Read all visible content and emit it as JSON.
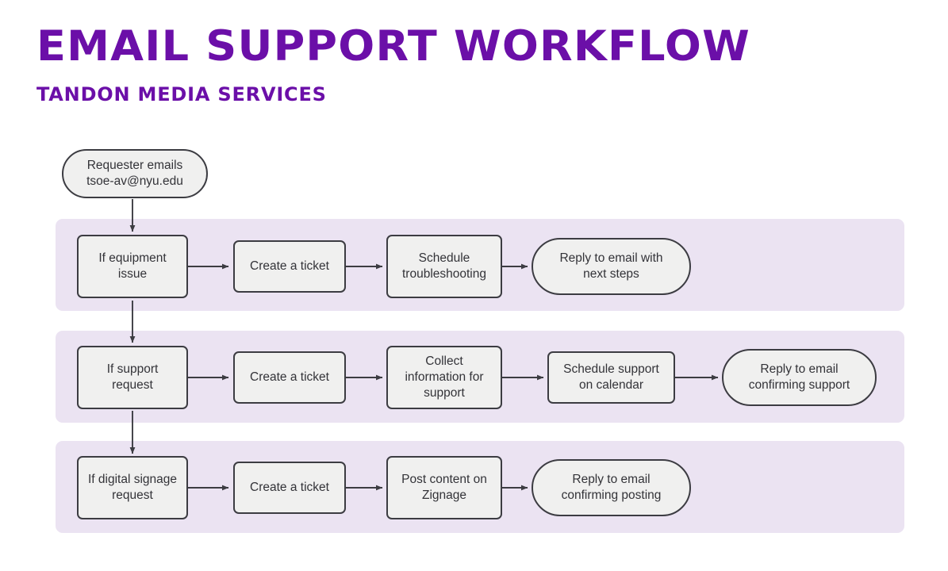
{
  "header": {
    "title": "EMAIL SUPPORT WORKFLOW",
    "subtitle": "TANDON MEDIA SERVICES"
  },
  "colors": {
    "title_purple": "#6b0fa8",
    "band_lavender": "#ebe3f2",
    "node_fill": "#f0f0ef",
    "node_stroke": "#3c3c42",
    "node_text": "#333338",
    "edge_stroke": "#3c3c42",
    "page_background": "#ffffff"
  },
  "diagram": {
    "type": "flowchart",
    "start_node": {
      "shape": "pill",
      "line1": "Requester emails",
      "line2": "tsoe-av@nyu.edu"
    },
    "lanes": [
      {
        "id": "equipment",
        "nodes": [
          {
            "shape": "rect",
            "line1": "If equipment",
            "line2": "issue"
          },
          {
            "shape": "rect",
            "line1": "Create a ticket",
            "line2": ""
          },
          {
            "shape": "rect",
            "line1": "Schedule",
            "line2": "troubleshooting"
          },
          {
            "shape": "pill",
            "line1": "Reply to email with",
            "line2": "next steps"
          }
        ]
      },
      {
        "id": "support",
        "nodes": [
          {
            "shape": "rect",
            "line1": "If support",
            "line2": "request"
          },
          {
            "shape": "rect",
            "line1": "Create a ticket",
            "line2": ""
          },
          {
            "shape": "rect",
            "line1": "Collect",
            "line2": "information for",
            "line3": "support"
          },
          {
            "shape": "rect",
            "line1": "Schedule support",
            "line2": "on calendar"
          },
          {
            "shape": "pill",
            "line1": "Reply to email",
            "line2": "confirming support"
          }
        ]
      },
      {
        "id": "signage",
        "nodes": [
          {
            "shape": "rect",
            "line1": "If digital signage",
            "line2": "request"
          },
          {
            "shape": "rect",
            "line1": "Create a ticket",
            "line2": ""
          },
          {
            "shape": "rect",
            "line1": "Post content on",
            "line2": "Zignage"
          },
          {
            "shape": "pill",
            "line1": "Reply to email",
            "line2": "confirming posting"
          }
        ]
      }
    ]
  }
}
